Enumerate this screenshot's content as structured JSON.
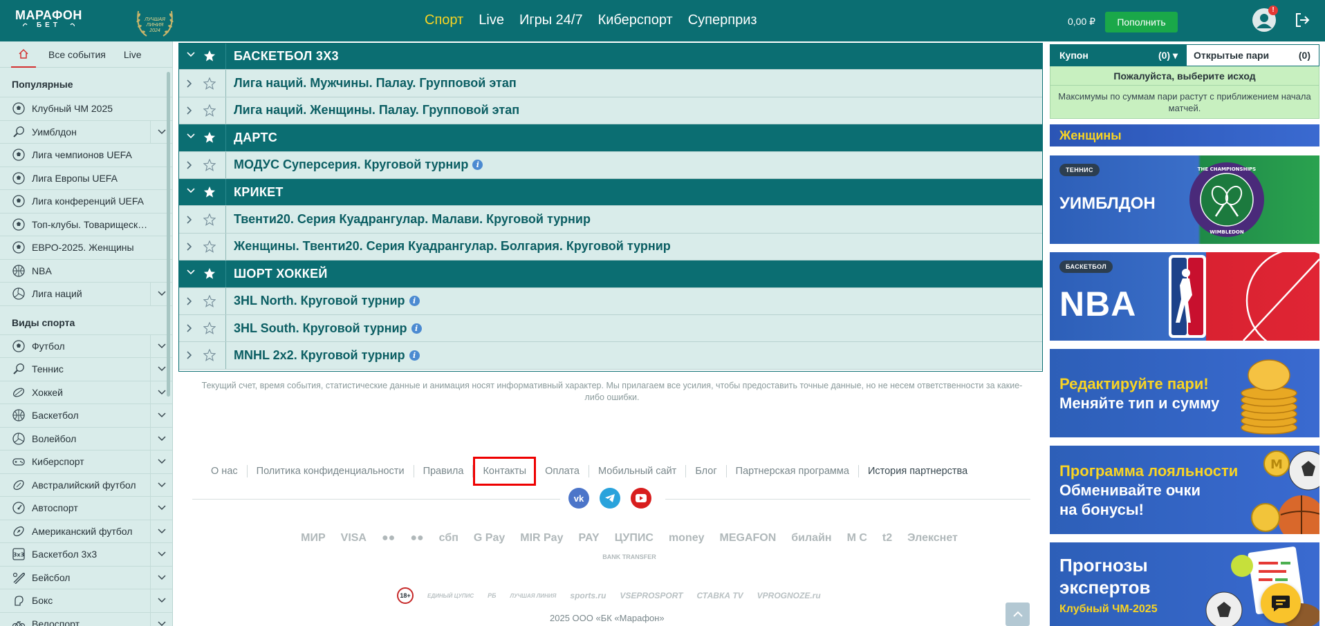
{
  "header": {
    "logo_line1": "МАРАФОН",
    "logo_line2": "БЕТ",
    "award_text": "ЛУЧШАЯ ЛИНИЯ 2024",
    "nav": [
      "Спорт",
      "Live",
      "Игры 24/7",
      "Киберспорт",
      "Суперприз"
    ],
    "balance": "0,00 ₽",
    "topup_label": "Пополнить",
    "notification_badge": "!"
  },
  "sidebar": {
    "tabs": {
      "all": "Все события",
      "live": "Live"
    },
    "popular_title": "Популярные",
    "popular": [
      {
        "label": "Клубный ЧМ 2025",
        "icon": "soccer-ball-icon",
        "expand": false
      },
      {
        "label": "Уимблдон",
        "icon": "tennis-racket-icon",
        "expand": true
      },
      {
        "label": "Лига чемпионов UEFA",
        "icon": "soccer-ball-icon",
        "expand": false
      },
      {
        "label": "Лига Европы UEFA",
        "icon": "soccer-ball-icon",
        "expand": false
      },
      {
        "label": "Лига конференций UEFA",
        "icon": "soccer-ball-icon",
        "expand": false
      },
      {
        "label": "Топ-клубы. Товарищеские матчи",
        "icon": "soccer-ball-icon",
        "expand": false
      },
      {
        "label": "ЕВРО-2025. Женщины",
        "icon": "soccer-ball-icon",
        "expand": false
      },
      {
        "label": "NBA",
        "icon": "basketball-icon",
        "expand": false
      },
      {
        "label": "Лига наций",
        "icon": "volleyball-icon",
        "expand": true
      }
    ],
    "sports_title": "Виды спорта",
    "sports": [
      {
        "label": "Футбол",
        "icon": "soccer-ball-icon"
      },
      {
        "label": "Теннис",
        "icon": "tennis-racket-icon"
      },
      {
        "label": "Хоккей",
        "icon": "hockey-puck-icon"
      },
      {
        "label": "Баскетбол",
        "icon": "basketball-icon"
      },
      {
        "label": "Волейбол",
        "icon": "volleyball-icon"
      },
      {
        "label": "Киберспорт",
        "icon": "gamepad-icon"
      },
      {
        "label": "Австралийский футбол",
        "icon": "rugby-ball-icon"
      },
      {
        "label": "Автоспорт",
        "icon": "speedometer-icon"
      },
      {
        "label": "Американский футбол",
        "icon": "american-football-icon"
      },
      {
        "label": "Баскетбол 3х3",
        "icon": "basketball-3x3-icon"
      },
      {
        "label": "Бейсбол",
        "icon": "baseball-bat-icon"
      },
      {
        "label": "Бокс",
        "icon": "boxing-glove-icon"
      },
      {
        "label": "Велоспорт",
        "icon": "bicycle-icon"
      }
    ]
  },
  "main": {
    "rows": [
      {
        "type": "sport",
        "title": "БАСКЕТБОЛ 3Х3",
        "info": false
      },
      {
        "type": "league",
        "title": "Лига наций. Мужчины. Палау. Групповой этап",
        "info": false
      },
      {
        "type": "league",
        "title": "Лига наций. Женщины. Палау. Групповой этап",
        "info": false
      },
      {
        "type": "sport",
        "title": "ДАРТС",
        "info": false
      },
      {
        "type": "league",
        "title": "МОДУС Суперсерия. Круговой турнир",
        "info": true
      },
      {
        "type": "sport",
        "title": "КРИКЕТ",
        "info": false
      },
      {
        "type": "league",
        "title": "Твенти20. Серия Куадрангулар. Малави. Круговой турнир",
        "info": false
      },
      {
        "type": "league",
        "title": "Женщины. Твенти20. Серия Куадрангулар. Болгария. Круговой турнир",
        "info": false
      },
      {
        "type": "sport",
        "title": "ШОРТ ХОККЕЙ",
        "info": false
      },
      {
        "type": "league",
        "title": "3HL North. Круговой турнир",
        "info": true
      },
      {
        "type": "league",
        "title": "3HL South. Круговой турнир",
        "info": true
      },
      {
        "type": "league",
        "title": "MNHL 2x2. Круговой турнир",
        "info": true
      }
    ],
    "disclaimer": "Текущий счет, время события, статистические данные и анимация носят информативный характер. Мы прилагаем все усилия, чтобы предоставить точные данные, но не несем ответственности за какие-либо ошибки."
  },
  "footer": {
    "links": [
      "О нас",
      "Политика конфиденциальности",
      "Правила",
      "Контакты",
      "Оплата",
      "Мобильный сайт",
      "Блог",
      "Партнерская программа",
      "История партнерства"
    ],
    "social": [
      "vk-icon",
      "telegram-icon",
      "youtube-icon"
    ],
    "payments": [
      "МИР",
      "VISA",
      "●●",
      "●●",
      "сбп",
      "G Pay",
      "MIR Pay",
      "PAY",
      "ЦУПИС",
      "money",
      "MEGAFON",
      "билайн",
      "М С",
      "t2",
      "Элекснет"
    ],
    "payments2": [
      "BANK TRANSFER"
    ],
    "partners": [
      "18+",
      "ЕДИНЫЙ ЦУПИС",
      "РБ",
      "ЛУЧШАЯ ЛИНИЯ",
      "sports.ru",
      "VSEPROSPORT",
      "СТАВКА TV",
      "VPROGNOZE.ru"
    ],
    "copyright": "2025 ООО «БК «Марафон»"
  },
  "coupon": {
    "tab_coupon": "Купон",
    "coupon_count": "(0)",
    "tab_open": "Открытые пари",
    "open_count": "(0)",
    "prompt": "Пожалуйста, выберите исход",
    "note": "Максимумы по суммам пари растут с приближением начала матчей."
  },
  "banners": {
    "b0_title": "Женщины",
    "b1_tag": "ТЕННИС",
    "b1_title": "УИМБЛДОН",
    "b1_ring": "THE CHAMPIONSHIPS · WIMBLEDON",
    "b2_tag": "БАСКЕТБОЛ",
    "b2_title": "NBA",
    "b3_line1": "Редактируйте пари!",
    "b3_line2": "Меняйте тип и сумму",
    "b4_line1": "Программа лояльности",
    "b4_line2": "Обменивайте очки",
    "b4_line3": "на бонусы!",
    "b5_line1": "Прогнозы",
    "b5_line2": "экспертов",
    "b5_line3": "Клубный ЧМ-2025"
  },
  "colors": {
    "brand_teal": "#0b6e72",
    "nav_active": "#f9d423",
    "topup_green": "#1aa849",
    "sidebar_bg": "#d9ecea",
    "coupon_bg": "#c8f0c0"
  }
}
